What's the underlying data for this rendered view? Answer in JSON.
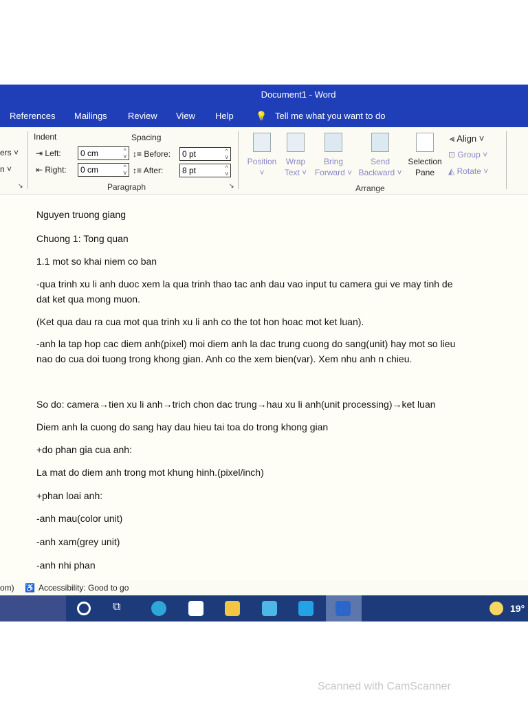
{
  "window": {
    "title": "Document1 - Word"
  },
  "tabs": [
    {
      "label": "References"
    },
    {
      "label": "Mailings"
    },
    {
      "label": "Review"
    },
    {
      "label": "View"
    },
    {
      "label": "Help"
    }
  ],
  "tell_me": "Tell me what you want to do",
  "ribbon": {
    "cut_left_1": "ers ˅",
    "cut_left_2": "n ˅",
    "indent": {
      "label": "Indent",
      "left_label": "Left:",
      "left_value": "0 cm",
      "right_label": "Right:",
      "right_value": "0 cm"
    },
    "spacing": {
      "label": "Spacing",
      "before_label": "Before:",
      "before_value": "0 pt",
      "after_label": "After:",
      "after_value": "8 pt"
    },
    "paragraph_group": "Paragraph",
    "arrange": {
      "position": "Position",
      "wrap": "Wrap",
      "wrap2": "Text ˅",
      "bring": "Bring",
      "bring2": "Forward ˅",
      "send": "Send",
      "send2": "Backward ˅",
      "selection": "Selection",
      "selection2": "Pane",
      "align": "Align ˅",
      "group": "Group ˅",
      "rotate": "Rotate ˅",
      "group_label": "Arrange"
    }
  },
  "document": {
    "lines": [
      "Nguyen truong giang",
      "Chuong 1: Tong quan",
      "1.1  mot so khai niem co ban",
      " -qua trinh xu li anh duoc xem la qua trinh thao tac anh dau vao input tu camera gui ve may tinh de",
      "dat ket qua mong muon.",
      "   (Ket qua dau ra cua mot qua trinh xu li anh co the tot hon hoac mot ket luan).",
      "-anh la tap hop cac diem anh(pixel) moi diem anh la dac trung cuong do sang(unit) hay mot so lieu",
      "nao do cua doi tuong trong khong gian. Anh co the xem bien(var). Xem nhu anh n chieu.",
      "So do: camera→tien xu li anh→trich chon dac trung→hau xu li anh(unit processing)→ket luan",
      "Diem anh la cuong do sang hay dau hieu tai toa do trong khong gian",
      "+do phan gia cua anh:",
      "  La mat do diem anh trong mot khung hinh.(pixel/inch)",
      "+phan loai anh:",
      "-anh mau(color unit)",
      "-anh xam(grey unit)",
      "-anh nhi phan"
    ]
  },
  "status": {
    "cut": "om)",
    "accessibility": "Accessibility: Good to go"
  },
  "taskbar": {
    "weather": "19°"
  },
  "watermark": "Scanned with CamScanner"
}
